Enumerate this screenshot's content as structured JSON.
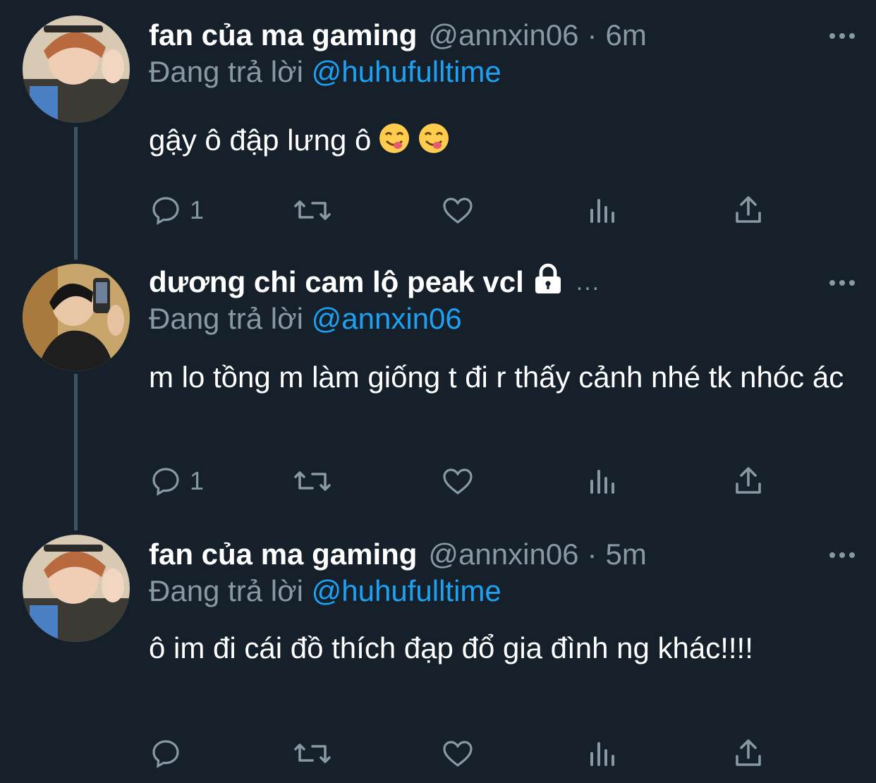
{
  "colors": {
    "background": "#15202b",
    "secondary_text": "#8899a6",
    "link": "#1da1f2",
    "thread_line": "#3d5466"
  },
  "tweets": [
    {
      "name": "fan của ma gaming",
      "handle": "@annxin06",
      "separator": "·",
      "time": "6m",
      "replying_label": "Đang trả lời",
      "replying_to": "@huhufulltime",
      "text": "gậy ô đập lưng ô",
      "emoji": [
        "face-savoring-food",
        "face-savoring-food"
      ],
      "reply_count": "1"
    },
    {
      "name": "dương chi cam lộ peak vcl",
      "protected": true,
      "truncated": "...",
      "replying_label": "Đang trả lời",
      "replying_to": "@annxin06",
      "text": "m lo tồng m làm giống t đi r thấy cảnh nhé tk nhóc ác",
      "reply_count": "1"
    },
    {
      "name": "fan của ma gaming",
      "handle": "@annxin06",
      "separator": "·",
      "time": "5m",
      "replying_label": "Đang trả lời",
      "replying_to": "@huhufulltime",
      "text": "ô im đi cái đồ thích đạp đổ gia đình ng khác!!!!",
      "reply_count": ""
    }
  ]
}
